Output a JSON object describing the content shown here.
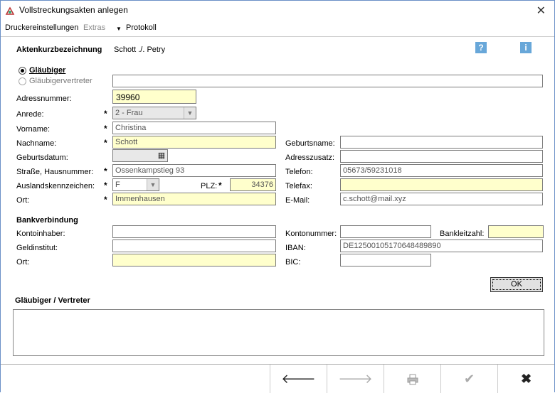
{
  "window": {
    "title": "Vollstreckungsakten anlegen"
  },
  "menu": {
    "drucker": "Druckereinstellungen",
    "extras": "Extras",
    "protokoll": "Protokoll",
    "help_icon": "?",
    "info_icon": "i"
  },
  "header": {
    "label": "Aktenkurzbezeichnung",
    "value": "Schott ./. Petry"
  },
  "radios": {
    "glaeubiger": "Gläubiger",
    "vertreter": "Gläubigervertreter"
  },
  "left": {
    "adressnummer_label": "Adressnummer:",
    "adressnummer": "39960",
    "anrede_label": "Anrede:",
    "anrede": "2 - Frau",
    "vorname_label": "Vorname:",
    "vorname": "Christina",
    "nachname_label": "Nachname:",
    "nachname": "Schott",
    "geburtsdatum_label": "Geburtsdatum:",
    "strasse_label": "Straße, Hausnummer:",
    "strasse": "Ossenkampstieg 93",
    "ausland_label": "Auslandskennzeichen:",
    "ausland": "F",
    "plz_label": "PLZ:",
    "plz": "34376",
    "ort_label": "Ort:",
    "ort": "Immenhausen"
  },
  "right": {
    "geburtsname_label": "Geburtsname:",
    "adresszusatz_label": "Adresszusatz:",
    "telefon_label": "Telefon:",
    "telefon": "05673/59231018",
    "telefax_label": "Telefax:",
    "email_label": "E-Mail:",
    "email": "c.schott@mail.xyz"
  },
  "bank": {
    "heading": "Bankverbindung",
    "kontoinhaber_label": "Kontoinhaber:",
    "geldinstitut_label": "Geldinstitut:",
    "ort_label": "Ort:",
    "kontonummer_label": "Kontonummer:",
    "bankleitzahl_label": "Bankleitzahl:",
    "iban_label": "IBAN:",
    "iban": "DE12500105170648489890",
    "bic_label": "BIC:"
  },
  "ok_button": "OK",
  "section2": {
    "heading": "Gläubiger / Vertreter"
  },
  "required_mark": "*",
  "colors": {
    "required_field": "#ffffcc",
    "help_icon": "#68a7d9"
  },
  "bottom_icons": [
    "arrow-left-icon",
    "arrow-right-icon",
    "printer-icon",
    "check-icon",
    "close-icon"
  ]
}
